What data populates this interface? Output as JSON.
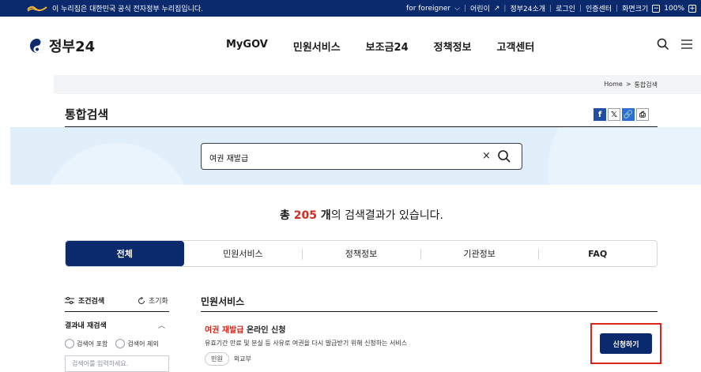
{
  "topbar": {
    "notice": "이 누리집은 대한민국 공식 전자정부 누리집입니다.",
    "links": [
      "for foreigner",
      "어린이",
      "정부24소개",
      "로그인",
      "인증센터",
      "화면크기"
    ],
    "zoom": "100%",
    "minus": "−",
    "plus": "+"
  },
  "header": {
    "logo": "정부24",
    "nav": [
      "MyGOV",
      "민원서비스",
      "보조금24",
      "정책정보",
      "고객센터"
    ]
  },
  "breadcrumb": {
    "home": "Home",
    "sep": ">",
    "current": "통합검색"
  },
  "page": {
    "title": "통합검색",
    "share": {
      "facebook": "f",
      "x": "𝕏",
      "link": "🔗",
      "print": "⎙"
    }
  },
  "search": {
    "value": "여권 재발급",
    "clear": "×"
  },
  "result_count": {
    "prefix": "총 ",
    "count": "205",
    "unit": " 개",
    "suffix": "의 검색결과가 있습니다."
  },
  "tabs": [
    "전체",
    "민원서비스",
    "정책정보",
    "기관정보",
    "FAQ"
  ],
  "filter": {
    "title": "조건검색",
    "reset": "초기화",
    "re_search_title": "결과내 재검색",
    "options": [
      "검색어 포함",
      "검색어 제외"
    ],
    "input_placeholder": "검색어를 입력하세요."
  },
  "results": {
    "section": "민원서비스",
    "items": [
      {
        "title_highlight": "여권 재발급",
        "title_rest": " 온라인 신청",
        "desc": "유효기간 만료 및 분실 등 사유로 여권을 다시 발급받기 위해 신청하는 서비스",
        "chip": "민원",
        "agency": "외교부",
        "action": "신청하기"
      }
    ]
  },
  "colors": {
    "navy": "#0b2a6e",
    "accent_red": "#d6281e",
    "band": "#e1effb"
  }
}
